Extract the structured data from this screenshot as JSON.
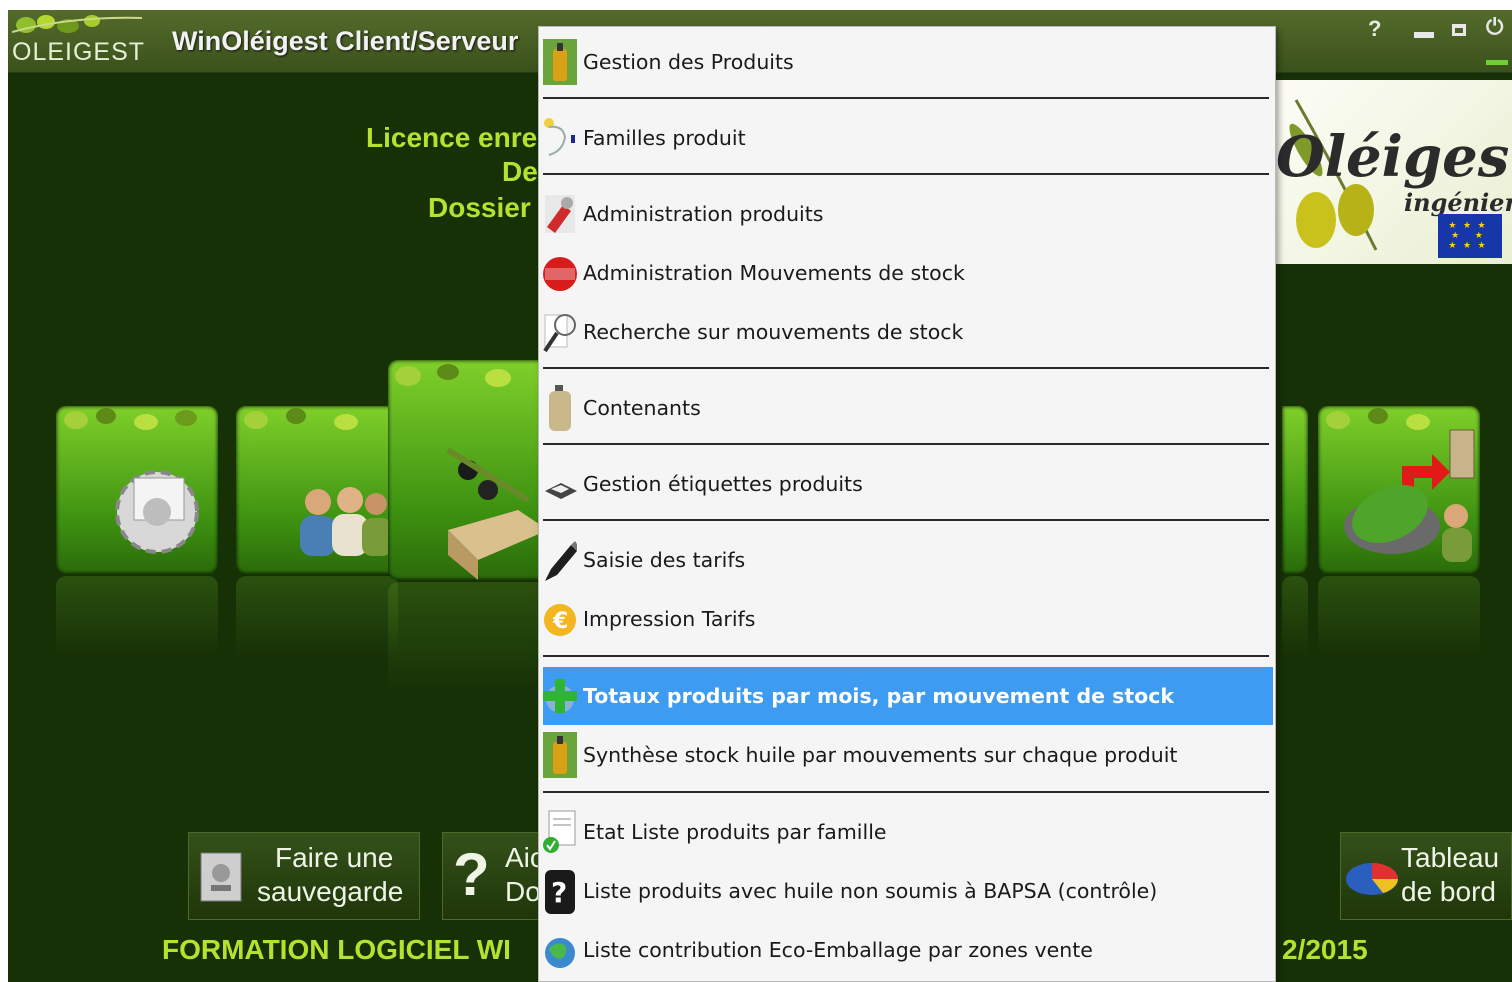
{
  "window": {
    "logo_text": "OLEIGEST",
    "title": "WinOléigest Client/Serveur",
    "help_label": "?",
    "power_label": "⏻"
  },
  "license": {
    "line1": "Licence enre",
    "line2": "De",
    "line3": "Dossier"
  },
  "brand": {
    "name": "Oléigest",
    "subtitle": "ingénierie"
  },
  "bottom_buttons": {
    "backup_line1": "Faire une",
    "backup_line2": "sauvegarde",
    "help_line1": "Aic",
    "help_line2": "Do",
    "dashboard_line1": "Tableau",
    "dashboard_line2": "de bord"
  },
  "footer": {
    "text": "FORMATION LOGICIEL WI",
    "date_fragment": "2/2015"
  },
  "menu": {
    "items": [
      {
        "label": "Gestion des Produits",
        "icon": "oil-bottle-icon"
      },
      {
        "label": "Familles produit",
        "icon": "family-tree-icon"
      },
      {
        "label": "Administration produits",
        "icon": "admin-tools-icon"
      },
      {
        "label": "Administration Mouvements de stock",
        "icon": "stock-stamp-icon"
      },
      {
        "label": "Recherche sur mouvements de stock",
        "icon": "magnifier-icon"
      },
      {
        "label": "Contenants",
        "icon": "container-bottle-icon"
      },
      {
        "label": "Gestion étiquettes produits",
        "icon": "label-printer-icon"
      },
      {
        "label": "Saisie des tarifs",
        "icon": "pen-icon"
      },
      {
        "label": "Impression Tarifs",
        "icon": "euro-icon"
      },
      {
        "label": "Totaux produits par mois, par mouvement de stock",
        "icon": "plus-globe-icon",
        "selected": true
      },
      {
        "label": "Synthèse stock huile par mouvements sur chaque produit",
        "icon": "oil-bottle-icon"
      },
      {
        "label": "Etat Liste produits par famille",
        "icon": "document-check-icon"
      },
      {
        "label": "Liste produits avec huile non soumis à BAPSA (contrôle)",
        "icon": "question-icon"
      },
      {
        "label": "Liste contribution Eco-Emballage par zones vente",
        "icon": "recycle-globe-icon"
      }
    ]
  },
  "colors": {
    "accent_selected": "#3d9bf2",
    "license_text": "#b6e22f",
    "background": "#173106"
  }
}
